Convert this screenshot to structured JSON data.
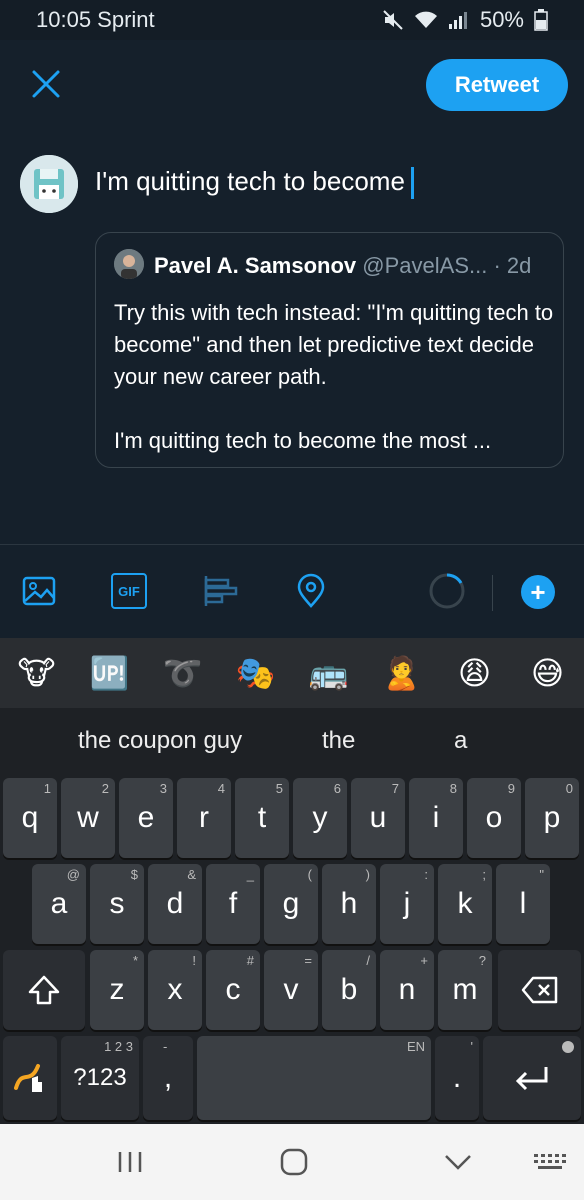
{
  "status_bar": {
    "time_carrier": "10:05 Sprint",
    "battery": "50%"
  },
  "header": {
    "retweet_label": "Retweet"
  },
  "composer": {
    "text": "I'm quitting tech to become"
  },
  "quoted_tweet": {
    "name": "Pavel A. Samsonov",
    "handle": "@PavelAS...",
    "age": "· 2d",
    "paragraph1": "Try this with tech instead: \"I'm quitting tech to become\" and then let predictive text decide your new career path.",
    "paragraph2": "I'm quitting tech to become the most ..."
  },
  "toolbar": {
    "gif_label": "GIF",
    "add_label": "+"
  },
  "emoji_bar": [
    "🐮",
    "🆙",
    "➰",
    "🎭",
    "🚌",
    "🙎",
    "😩",
    "😅"
  ],
  "suggestions": [
    "the coupon guy",
    "the",
    "a"
  ],
  "keyboard": {
    "row1": [
      {
        "k": "q",
        "s": "1"
      },
      {
        "k": "w",
        "s": "2"
      },
      {
        "k": "e",
        "s": "3"
      },
      {
        "k": "r",
        "s": "4"
      },
      {
        "k": "t",
        "s": "5"
      },
      {
        "k": "y",
        "s": "6"
      },
      {
        "k": "u",
        "s": "7"
      },
      {
        "k": "i",
        "s": "8"
      },
      {
        "k": "o",
        "s": "9"
      },
      {
        "k": "p",
        "s": "0"
      }
    ],
    "row2": [
      {
        "k": "a",
        "s": "@"
      },
      {
        "k": "s",
        "s": "$"
      },
      {
        "k": "d",
        "s": "&"
      },
      {
        "k": "f",
        "s": "_"
      },
      {
        "k": "g",
        "s": "("
      },
      {
        "k": "h",
        "s": ")"
      },
      {
        "k": "j",
        "s": ":"
      },
      {
        "k": "k",
        "s": ";"
      },
      {
        "k": "l",
        "s": "\""
      }
    ],
    "row3": [
      {
        "k": "z",
        "s": "*"
      },
      {
        "k": "x",
        "s": "!"
      },
      {
        "k": "c",
        "s": "#"
      },
      {
        "k": "v",
        "s": "="
      },
      {
        "k": "b",
        "s": "/"
      },
      {
        "k": "n",
        "s": "+"
      },
      {
        "k": "m",
        "s": "?"
      }
    ],
    "symbols_label": "?123",
    "symbols_sup": "1 2 3",
    "comma": ",",
    "comma_sup": "-",
    "space_sup": "EN",
    "period": ".",
    "period_sup": "'"
  },
  "colors": {
    "accent": "#1da1f2",
    "background": "#15202b",
    "key": "#3b3f44"
  }
}
